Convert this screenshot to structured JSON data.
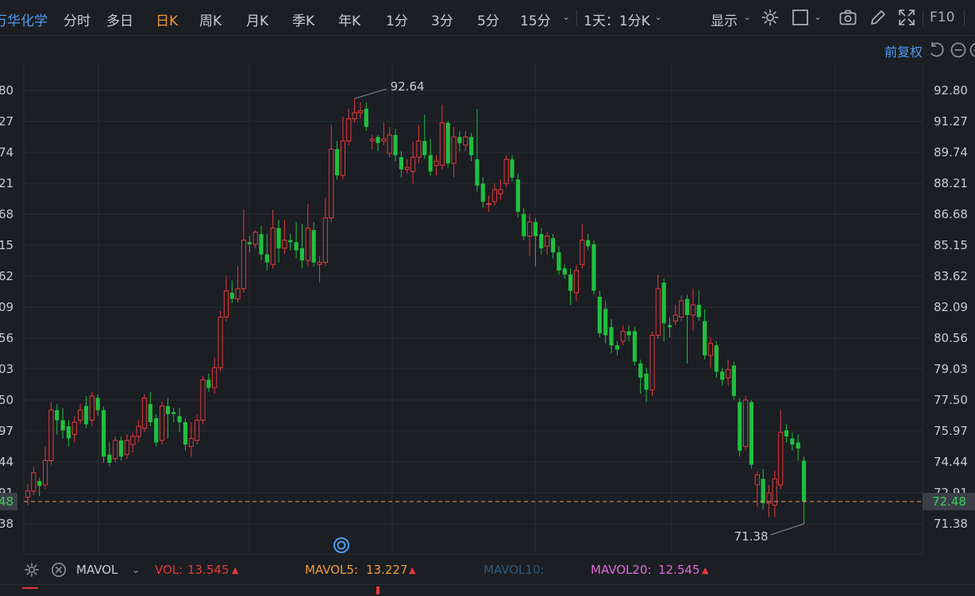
{
  "toolbar": {
    "stock_name": "万华化学",
    "periods": [
      "分时",
      "多日",
      "日K",
      "周K",
      "月K",
      "季K",
      "年K",
      "1分",
      "3分",
      "5分",
      "15分"
    ],
    "active_period": "日K",
    "interval_select": "1天：1分K",
    "display_label": "显示",
    "f10_label": "F10"
  },
  "adjust_label": "前复权",
  "price_axis": {
    "ticks_right": [
      "92.80",
      "91.27",
      "89.74",
      "88.21",
      "86.68",
      "85.15",
      "83.62",
      "82.09",
      "80.56",
      "79.03",
      "77.50",
      "75.97",
      "74.44",
      "72.91",
      "71.38"
    ],
    "ticks_left": [
      "80",
      "27",
      "74",
      "21",
      "68",
      "15",
      "62",
      "09",
      "56",
      "03",
      "50",
      "97",
      "44",
      "91",
      "38"
    ],
    "current_price": "72.48",
    "current_price_left": "48",
    "ylim": [
      71.38,
      92.8
    ]
  },
  "annotations": {
    "high": "92.64",
    "low": "71.38"
  },
  "colors": {
    "up": "#e4393c",
    "down": "#1fbf3f",
    "bg": "#1b1e23",
    "grid": "#2a2e35",
    "axis_text": "#c8ccd2",
    "current_line": "#e5a06a"
  },
  "chart_data": {
    "type": "candlestick",
    "ylim": [
      71.38,
      92.8
    ],
    "candles": [
      [
        72.7,
        73.0,
        73.35,
        72.3
      ],
      [
        73.0,
        73.9,
        74.2,
        72.8
      ],
      [
        73.5,
        73.25,
        73.65,
        72.75
      ],
      [
        73.3,
        74.5,
        75.2,
        73.1
      ],
      [
        74.5,
        77.0,
        77.4,
        74.3
      ],
      [
        77.0,
        76.5,
        77.3,
        75.8
      ],
      [
        76.5,
        76.0,
        77.1,
        75.6
      ],
      [
        76.2,
        75.6,
        76.5,
        75.2
      ],
      [
        75.8,
        76.4,
        76.7,
        75.4
      ],
      [
        76.5,
        77.0,
        77.3,
        76.3
      ],
      [
        77.2,
        76.3,
        77.7,
        76.1
      ],
      [
        76.5,
        77.7,
        77.9,
        76.2
      ],
      [
        77.6,
        77.0,
        77.8,
        76.7
      ],
      [
        77.0,
        74.7,
        77.2,
        74.4
      ],
      [
        74.8,
        74.4,
        75.4,
        74.2
      ],
      [
        74.6,
        75.5,
        75.7,
        74.4
      ],
      [
        75.5,
        74.7,
        75.7,
        74.5
      ],
      [
        74.8,
        75.5,
        75.8,
        74.6
      ],
      [
        75.3,
        75.7,
        75.9,
        74.9
      ],
      [
        75.7,
        76.2,
        76.5,
        75.4
      ],
      [
        76.1,
        77.6,
        77.8,
        75.9
      ],
      [
        77.3,
        76.4,
        77.9,
        76.2
      ],
      [
        76.6,
        75.4,
        76.8,
        75.2
      ],
      [
        75.5,
        77.2,
        77.4,
        75.3
      ],
      [
        77.2,
        76.8,
        77.6,
        75.6
      ],
      [
        76.9,
        76.8,
        77.1,
        76.4
      ],
      [
        76.7,
        76.4,
        77.1,
        75.9
      ],
      [
        76.4,
        75.3,
        76.6,
        75.0
      ],
      [
        75.2,
        75.6,
        76.4,
        74.7
      ],
      [
        75.5,
        76.5,
        76.8,
        75.3
      ],
      [
        76.5,
        78.5,
        78.7,
        76.3
      ],
      [
        78.5,
        78.1,
        78.8,
        77.9
      ],
      [
        78.1,
        79.1,
        79.6,
        77.8
      ],
      [
        79.1,
        81.6,
        81.9,
        78.9
      ],
      [
        81.6,
        82.9,
        83.6,
        81.4
      ],
      [
        82.8,
        82.5,
        83.4,
        82.3
      ],
      [
        82.5,
        83.0,
        84.1,
        82.3
      ],
      [
        83.0,
        85.4,
        86.9,
        82.8
      ],
      [
        85.3,
        85.2,
        85.6,
        84.8
      ],
      [
        85.2,
        85.8,
        85.9,
        85.0
      ],
      [
        85.7,
        84.7,
        86.1,
        84.4
      ],
      [
        84.7,
        84.3,
        85.7,
        83.9
      ],
      [
        84.2,
        86.0,
        86.9,
        84.0
      ],
      [
        86.0,
        85.0,
        86.4,
        84.3
      ],
      [
        85.0,
        85.4,
        86.4,
        84.7
      ],
      [
        85.4,
        85.3,
        85.7,
        84.9
      ],
      [
        85.3,
        84.9,
        86.3,
        84.5
      ],
      [
        85.0,
        84.4,
        86.2,
        84.0
      ],
      [
        84.4,
        86.0,
        87.2,
        84.1
      ],
      [
        85.9,
        84.3,
        86.3,
        84.1
      ],
      [
        84.2,
        84.3,
        84.6,
        83.3
      ],
      [
        84.3,
        86.5,
        87.5,
        84.1
      ],
      [
        86.5,
        89.9,
        91.1,
        86.3
      ],
      [
        89.9,
        88.6,
        90.3,
        88.4
      ],
      [
        88.6,
        90.3,
        91.5,
        88.4
      ],
      [
        90.3,
        91.4,
        91.9,
        90.1
      ],
      [
        91.4,
        91.7,
        92.4,
        91.2
      ],
      [
        91.7,
        91.8,
        92.2,
        91.4
      ],
      [
        91.9,
        91.0,
        92.2,
        90.8
      ],
      [
        90.3,
        90.4,
        90.6,
        89.9
      ],
      [
        90.5,
        90.2,
        90.6,
        89.8
      ],
      [
        90.3,
        90.4,
        91.2,
        90.1
      ],
      [
        89.7,
        90.6,
        91.0,
        89.5
      ],
      [
        90.6,
        89.6,
        90.9,
        89.3
      ],
      [
        89.5,
        88.9,
        89.8,
        88.5
      ],
      [
        88.9,
        89.0,
        89.4,
        88.7
      ],
      [
        88.8,
        89.5,
        90.3,
        88.2
      ],
      [
        89.5,
        90.3,
        91.1,
        89.2
      ],
      [
        90.3,
        89.6,
        91.6,
        89.4
      ],
      [
        89.6,
        88.8,
        90.4,
        88.6
      ],
      [
        89.1,
        89.3,
        89.6,
        88.6
      ],
      [
        89.1,
        91.2,
        92.1,
        88.9
      ],
      [
        91.2,
        89.2,
        91.3,
        89.0
      ],
      [
        89.2,
        90.5,
        91.0,
        88.5
      ],
      [
        90.5,
        90.2,
        90.8,
        89.8
      ],
      [
        90.1,
        90.5,
        90.8,
        89.8
      ],
      [
        90.5,
        89.6,
        90.7,
        89.3
      ],
      [
        89.4,
        88.1,
        91.9,
        87.8
      ],
      [
        88.2,
        87.3,
        88.5,
        87.0
      ],
      [
        87.2,
        87.2,
        87.6,
        86.8
      ],
      [
        87.3,
        87.9,
        88.2,
        87.1
      ],
      [
        87.7,
        87.9,
        88.4,
        87.4
      ],
      [
        88.2,
        89.4,
        89.6,
        88.0
      ],
      [
        89.4,
        88.5,
        89.6,
        88.3
      ],
      [
        88.4,
        86.8,
        88.7,
        86.5
      ],
      [
        86.7,
        85.6,
        87.0,
        85.4
      ],
      [
        85.6,
        86.3,
        86.7,
        84.6
      ],
      [
        86.3,
        85.6,
        86.5,
        84.1
      ],
      [
        85.7,
        85.0,
        86.0,
        84.7
      ],
      [
        85.1,
        85.6,
        85.8,
        84.7
      ],
      [
        85.5,
        84.8,
        85.7,
        84.5
      ],
      [
        84.8,
        83.9,
        85.1,
        83.7
      ],
      [
        84.0,
        83.7,
        84.2,
        83.5
      ],
      [
        83.7,
        82.9,
        84.0,
        82.2
      ],
      [
        82.8,
        83.9,
        84.2,
        82.4
      ],
      [
        84.2,
        85.4,
        86.2,
        84.0
      ],
      [
        85.4,
        85.1,
        85.7,
        84.9
      ],
      [
        85.2,
        82.9,
        85.4,
        82.7
      ],
      [
        82.6,
        80.8,
        82.9,
        80.6
      ],
      [
        82.0,
        80.7,
        82.4,
        80.3
      ],
      [
        81.1,
        80.2,
        81.5,
        79.8
      ],
      [
        80.2,
        80.0,
        80.4,
        79.7
      ],
      [
        80.4,
        80.9,
        81.2,
        80.2
      ],
      [
        80.9,
        80.7,
        81.2,
        80.4
      ],
      [
        80.9,
        79.4,
        81.1,
        79.2
      ],
      [
        79.3,
        78.6,
        79.5,
        77.8
      ],
      [
        78.8,
        78.0,
        79.1,
        77.4
      ],
      [
        78.0,
        80.7,
        80.9,
        77.7
      ],
      [
        80.7,
        83.0,
        83.7,
        80.5
      ],
      [
        83.3,
        81.3,
        83.5,
        80.4
      ],
      [
        81.2,
        81.1,
        81.6,
        80.6
      ],
      [
        81.4,
        81.7,
        82.2,
        81.2
      ],
      [
        81.6,
        82.4,
        82.7,
        81.4
      ],
      [
        82.5,
        81.7,
        82.7,
        79.3
      ],
      [
        81.7,
        82.2,
        83.0,
        80.9
      ],
      [
        82.2,
        81.6,
        82.9,
        81.4
      ],
      [
        81.4,
        79.7,
        82.0,
        79.5
      ],
      [
        79.7,
        80.3,
        80.6,
        79.1
      ],
      [
        80.2,
        78.9,
        80.4,
        78.6
      ],
      [
        78.9,
        78.5,
        79.1,
        78.2
      ],
      [
        78.6,
        79.0,
        79.5,
        78.2
      ],
      [
        79.2,
        77.7,
        79.4,
        77.5
      ],
      [
        77.4,
        75.0,
        77.6,
        74.7
      ],
      [
        75.2,
        77.5,
        77.7,
        75.0
      ],
      [
        77.4,
        74.3,
        77.5,
        74.1
      ],
      [
        73.3,
        73.8,
        74.0,
        72.2
      ],
      [
        73.6,
        72.4,
        74.1,
        72.1
      ],
      [
        72.4,
        72.9,
        73.3,
        71.7
      ],
      [
        72.3,
        73.6,
        74.0,
        71.7
      ],
      [
        73.3,
        75.9,
        77.0,
        73.1
      ],
      [
        76.0,
        75.7,
        76.3,
        75.4
      ],
      [
        75.6,
        75.3,
        75.9,
        75.0
      ],
      [
        75.4,
        75.1,
        75.8,
        74.5
      ],
      [
        74.5,
        72.48,
        74.7,
        71.38
      ]
    ]
  },
  "volume_bar": {
    "indicator": "MAVOL",
    "vol_label": "VOL:",
    "vol_value": "13.545",
    "mavol5_label": "MAVOL5:",
    "mavol5_value": "13.227",
    "mavol10_label": "MAVOL10:",
    "mavol20_label": "MAVOL20:",
    "mavol20_value": "12.545"
  }
}
